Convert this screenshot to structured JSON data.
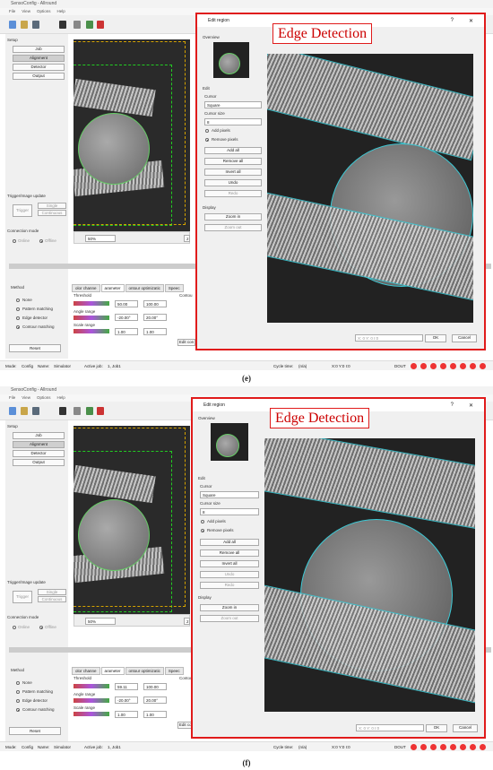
{
  "app": {
    "title": "SensoConfig - Allround",
    "menu": [
      "File",
      "View",
      "Options",
      "Help"
    ],
    "sections": {
      "setup": "Setup",
      "trigger": "Trigger/Image update",
      "connection": "Connection mode",
      "method": "Method"
    },
    "setup_buttons": [
      "Job",
      "Alignment",
      "Detector",
      "Output"
    ],
    "trigger_buttons": {
      "trigger": "Trigger",
      "single": "Single",
      "continuous": "Continuous"
    },
    "connection_modes": [
      "Online",
      "Offline"
    ],
    "methods": [
      "None",
      "Pattern matching",
      "Edge detector",
      "Contour matching"
    ],
    "reset": "Reset",
    "zoom": "50%",
    "page_field": "2",
    "tabs": [
      "olor channe",
      "arameter",
      "ontour optimizatic",
      "Speec",
      "Contou"
    ],
    "params": {
      "threshold": "Threshold",
      "angle": "Angle range",
      "scale": "Scale range",
      "edit_cont": "Edit con"
    }
  },
  "panels": [
    {
      "caption": "(e)",
      "threshold": [
        "50.00",
        "100.00"
      ],
      "angle": [
        "-20.00°",
        "20.00°"
      ],
      "scale": [
        "1.00",
        "1.00"
      ]
    },
    {
      "caption": "(f)",
      "threshold": [
        "59.11",
        "100.00"
      ],
      "angle": [
        "-20.00°",
        "20.00°"
      ],
      "scale": [
        "1.00",
        "1.00"
      ]
    }
  ],
  "status": {
    "mode": "Mode:",
    "mode_val": "Config",
    "name": "Name:",
    "name_val": "Simulator",
    "job": "Active job:",
    "job_val": "1, Job1",
    "cycle": "Cycle time:",
    "cycle_val": "(n/a)",
    "xy": "X:0 Y:0 I:0",
    "dout": "DOUT",
    "dots": [
      "1",
      "2",
      "3",
      "4",
      "5",
      "6",
      "7",
      "8"
    ]
  },
  "dialog": {
    "title": "Edit region",
    "help": "?",
    "close": "✕",
    "overview": "Overview",
    "edit": "Edit",
    "cursor": "Cursor",
    "cursor_value": "Square",
    "cursor_size": "Cursor size",
    "size_value": "8",
    "add_pixels": "Add pixels",
    "remove_pixels": "Remove pixels",
    "actions": [
      "Add all",
      "Remove all",
      "Invert all",
      "Undo",
      "Redo"
    ],
    "display": "Display",
    "zoom_in": "Zoom in",
    "zoom_out": "Zoom out",
    "coords": "X: 0 Y: 0 I:0",
    "ok": "OK",
    "cancel": "Cancel"
  },
  "annotation": "Edge Detection",
  "colors": {
    "accent_red": "#e01b1b",
    "cyan_edge": "#3cc8d4",
    "green_overlay": "#22cc22"
  }
}
